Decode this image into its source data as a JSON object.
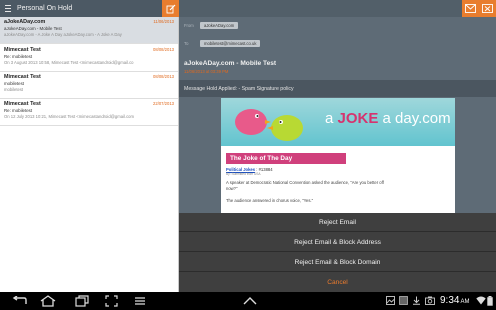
{
  "left_pane": {
    "title": "Personal On Hold",
    "messages": [
      {
        "from": "aJokeADay.com",
        "date": "11/06/2013",
        "subject": "aJokeADay.com - Mobile Test",
        "preview": "aJokeADay.com - A Joke A Day        aJokeADay.com - A Joke A Day"
      },
      {
        "from": "Mimecast Test",
        "date": "08/08/2013",
        "subject": "Re: mobiletest",
        "preview": "On 3 August 2013 10:58, Mimecast Test <mimecastandroid@gmail.co"
      },
      {
        "from": "Mimecast Test",
        "date": "08/08/2013",
        "subject": "mobiletest",
        "preview": "mobiletest"
      },
      {
        "from": "Mimecast Test",
        "date": "22/07/2013",
        "subject": "Re: mobiletest",
        "preview": "On 12 July 2013 10:21, Mimecast Test <mimecastandroid@gmail.com"
      }
    ]
  },
  "email": {
    "from_label": "From",
    "from_value": "aJokeADay.com",
    "to_label": "To",
    "to_value": "mobiletest@mimecast.co.uk",
    "subject": "aJokeADay.com - Mobile Test",
    "date": "11/06/2013 at 03:39 PM",
    "hold_notice": "Message Hold Applied: - Spam Signature policy"
  },
  "body": {
    "banner_prefix": "a ",
    "banner_joke": "JOKE",
    "banner_suffix": " a day.com",
    "box_title": "The Joke of The Day",
    "category": "Political Jokes",
    "joke_number": " : #13884",
    "byline": "By: Submitted from USA",
    "paragraph1": "A speaker at Democratic National Convention asked the audience, \"Are you better off now?\"",
    "paragraph2": "The audience answered in chorus voice, \"Yes.\""
  },
  "action_sheet": {
    "items": [
      "Reject Email",
      "Reject Email & Block Address",
      "Reject Email & Block Domain",
      "Cancel"
    ]
  },
  "status_bar": {
    "time": "9:34",
    "ampm": "AM"
  },
  "colors": {
    "accent": "#e87d2e",
    "header_bar": "#4c5964",
    "reader_bg": "#5e6b76",
    "joke_pink": "#d0407c"
  }
}
